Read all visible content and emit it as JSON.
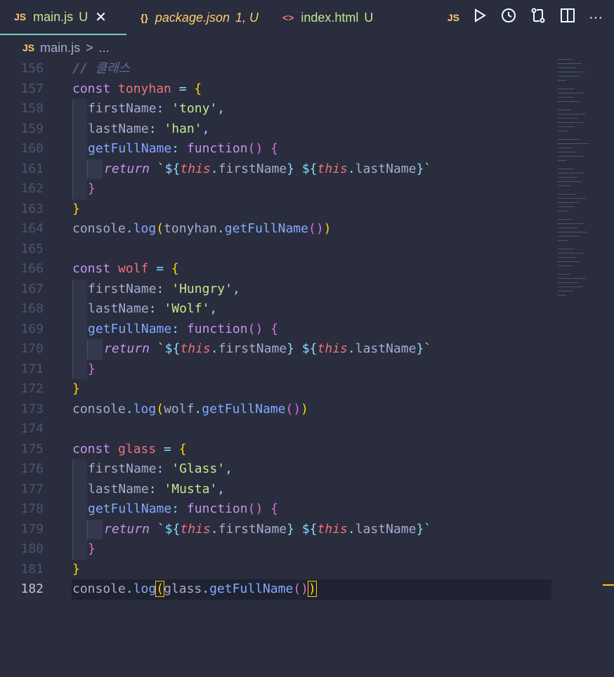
{
  "tabs": [
    {
      "icon": "JS",
      "name": "main.js",
      "status": "U",
      "active": true
    },
    {
      "icon": "{}",
      "name": "package.json",
      "status": "1, U",
      "active": false
    },
    {
      "icon": "<>",
      "name": "index.html",
      "status": "U",
      "active": false
    }
  ],
  "actions": {
    "js_label": "JS"
  },
  "breadcrumb": {
    "icon": "JS",
    "file": "main.js",
    "sep": ">",
    "rest": "..."
  },
  "lines": {
    "n156": "156",
    "n157": "157",
    "n158": "158",
    "n159": "159",
    "n160": "160",
    "n161": "161",
    "n162": "162",
    "n163": "163",
    "n164": "164",
    "n165": "165",
    "n166": "166",
    "n167": "167",
    "n168": "168",
    "n169": "169",
    "n170": "170",
    "n171": "171",
    "n172": "172",
    "n173": "173",
    "n174": "174",
    "n175": "175",
    "n176": "176",
    "n177": "177",
    "n178": "178",
    "n179": "179",
    "n180": "180",
    "n181": "181",
    "n182": "182"
  },
  "code": {
    "comment": "// 클래스",
    "kw_const": "const",
    "kw_function": "function",
    "kw_return": "return",
    "kw_this": "this",
    "obj1": "tonyhan",
    "obj2": "wolf",
    "obj3": "glass",
    "eq": " = ",
    "prop_first": "firstName",
    "prop_last": "lastName",
    "prop_get": "getFullName",
    "colon": ": ",
    "comma": ",",
    "first1": "'tony'",
    "last1": "'han'",
    "first2": "'Hungry'",
    "last2": "'Wolf'",
    "first3": "'Glass'",
    "last3": "'Musta'",
    "console": "console",
    "log": "log",
    "dot": ".",
    "tpl_open": "`",
    "dollar": "${",
    "close_b": "}",
    "ob": "{",
    "cb": "}",
    "op": "(",
    "cp": ")",
    "parens": "()",
    "space": " "
  },
  "colors": {
    "background": "#292d3e",
    "keyword": "#c792ea",
    "variable": "#f07178",
    "string": "#c3e88d",
    "function": "#82aaff",
    "punctuation": "#89ddff",
    "bracket1": "#ffd700",
    "bracket2": "#da70d6",
    "bracket3": "#179fff",
    "comment": "#676e95"
  },
  "icons": [
    "run-icon",
    "history-icon",
    "compare-icon",
    "split-editor-icon",
    "more-icon",
    "close-icon"
  ]
}
